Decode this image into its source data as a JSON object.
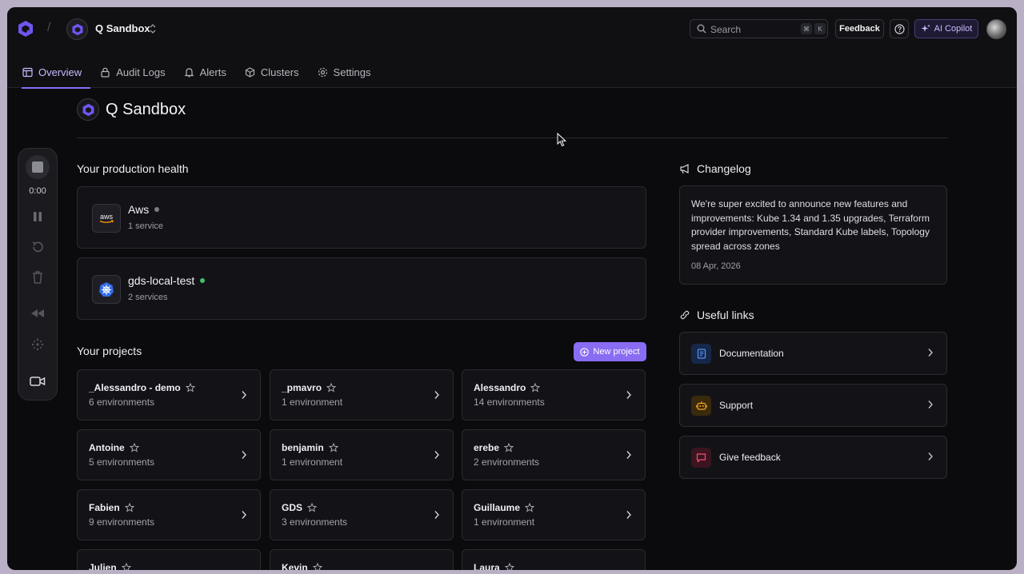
{
  "header": {
    "org_name": "Q Sandbox",
    "search_placeholder": "Search",
    "search_keys": [
      "⌘",
      "K"
    ],
    "feedback_label": "Feedback",
    "ai_label": "AI Copilot",
    "accent_color": "#8b6cf6"
  },
  "tabs": [
    {
      "label": "Overview",
      "icon": "layout-icon",
      "active": true
    },
    {
      "label": "Audit Logs",
      "icon": "lock-icon",
      "active": false
    },
    {
      "label": "Alerts",
      "icon": "bell-icon",
      "active": false
    },
    {
      "label": "Clusters",
      "icon": "cube-icon",
      "active": false
    },
    {
      "label": "Settings",
      "icon": "gear-icon",
      "active": false
    }
  ],
  "recorder": {
    "time": "0:00"
  },
  "page": {
    "title": "Q Sandbox"
  },
  "health": {
    "title": "Your production health",
    "clusters": [
      {
        "name": "Aws",
        "services": "1 service",
        "status_color": "#7c7c84",
        "icon": "aws-icon"
      },
      {
        "name": "gds-local-test",
        "services": "2 services",
        "status_color": "#3fbf6a",
        "icon": "kubernetes-icon"
      }
    ]
  },
  "projects": {
    "title": "Your projects",
    "new_label": "New project",
    "items": [
      {
        "name": "_Alessandro - demo",
        "envs": "6 environments"
      },
      {
        "name": "_pmavro",
        "envs": "1 environment"
      },
      {
        "name": "Alessandro",
        "envs": "14 environments"
      },
      {
        "name": "Antoine",
        "envs": "5 environments"
      },
      {
        "name": "benjamin",
        "envs": "1 environment"
      },
      {
        "name": "erebe",
        "envs": "2 environments"
      },
      {
        "name": "Fabien",
        "envs": "9 environments"
      },
      {
        "name": "GDS",
        "envs": "3 environments"
      },
      {
        "name": "Guillaume",
        "envs": "1 environment"
      },
      {
        "name": "Julien",
        "envs": ""
      },
      {
        "name": "Kevin",
        "envs": ""
      },
      {
        "name": "Laura",
        "envs": ""
      }
    ]
  },
  "changelog": {
    "title": "Changelog",
    "text": "We're super excited to announce new features and improvements: Kube 1.34 and 1.35 upgrades, Terraform provider improvements, Standard Kube labels, Topology spread across zones",
    "date": "08 Apr, 2026"
  },
  "links": {
    "title": "Useful links",
    "items": [
      {
        "label": "Documentation",
        "icon": "document-icon",
        "color": "#3b82f6"
      },
      {
        "label": "Support",
        "icon": "robot-icon",
        "color": "#f59e0b"
      },
      {
        "label": "Give feedback",
        "icon": "message-icon",
        "color": "#ef4461"
      }
    ]
  }
}
